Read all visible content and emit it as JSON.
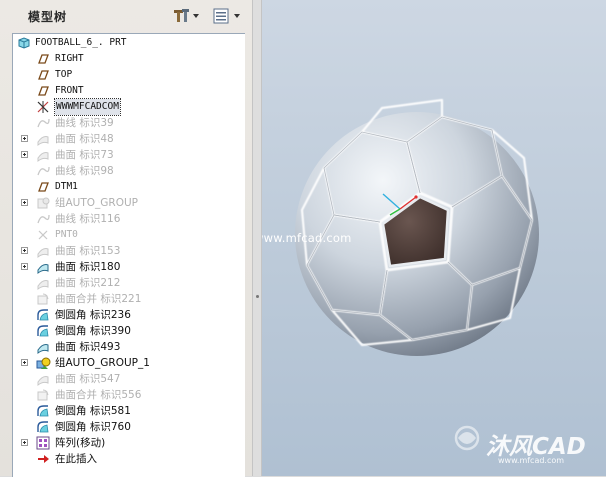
{
  "panel": {
    "title": "模型树",
    "settings_icon": "tools-icon",
    "show_icon": "list-icon"
  },
  "tree": {
    "root": "FOOTBALL_6_. PRT",
    "items": [
      {
        "label": "RIGHT",
        "icon": "datum-plane-icon",
        "state": "normal",
        "expander": false,
        "mono": true
      },
      {
        "label": "TOP",
        "icon": "datum-plane-icon",
        "state": "normal",
        "expander": false,
        "mono": true
      },
      {
        "label": "FRONT",
        "icon": "datum-plane-icon",
        "state": "normal",
        "expander": false,
        "mono": true
      },
      {
        "label": "WWWMFCADCOM",
        "icon": "coordinate-system-icon",
        "state": "selected",
        "expander": false,
        "mono": true
      },
      {
        "label": "曲线 标识39",
        "icon": "curve-icon",
        "state": "suppressed",
        "expander": false,
        "mono": false
      },
      {
        "label": "曲面 标识48",
        "icon": "surface-icon",
        "state": "suppressed",
        "expander": true,
        "mono": false
      },
      {
        "label": "曲面 标识73",
        "icon": "surface-icon",
        "state": "suppressed",
        "expander": true,
        "mono": false
      },
      {
        "label": "曲线 标识98",
        "icon": "curve-icon",
        "state": "suppressed",
        "expander": false,
        "mono": false
      },
      {
        "label": "DTM1",
        "icon": "datum-plane-icon",
        "state": "normal",
        "expander": false,
        "mono": true
      },
      {
        "label": "组AUTO_GROUP",
        "icon": "group-icon",
        "state": "suppressed",
        "expander": true,
        "mono": false
      },
      {
        "label": "曲线 标识116",
        "icon": "curve-icon",
        "state": "suppressed",
        "expander": false,
        "mono": false
      },
      {
        "label": "PNT0",
        "icon": "datum-point-icon",
        "state": "suppressed",
        "expander": false,
        "mono": true
      },
      {
        "label": "曲面 标识153",
        "icon": "surface-icon",
        "state": "suppressed",
        "expander": true,
        "mono": false
      },
      {
        "label": "曲面 标识180",
        "icon": "surface-icon",
        "state": "normal",
        "expander": true,
        "mono": false
      },
      {
        "label": "曲面 标识212",
        "icon": "surface-icon",
        "state": "suppressed",
        "expander": false,
        "mono": false
      },
      {
        "label": "曲面合并 标识221",
        "icon": "merge-icon",
        "state": "suppressed",
        "expander": false,
        "mono": false
      },
      {
        "label": "倒圆角 标识236",
        "icon": "round-icon",
        "state": "normal",
        "expander": false,
        "mono": false
      },
      {
        "label": "倒圆角 标识390",
        "icon": "round-icon",
        "state": "normal",
        "expander": false,
        "mono": false
      },
      {
        "label": "曲面 标识493",
        "icon": "surface-icon",
        "state": "normal",
        "expander": false,
        "mono": false
      },
      {
        "label": "组AUTO_GROUP_1",
        "icon": "group-icon",
        "state": "normal",
        "expander": true,
        "mono": false
      },
      {
        "label": "曲面 标识547",
        "icon": "surface-icon",
        "state": "suppressed",
        "expander": false,
        "mono": false
      },
      {
        "label": "曲面合并 标识556",
        "icon": "merge-icon",
        "state": "suppressed",
        "expander": false,
        "mono": false
      },
      {
        "label": "倒圆角 标识581",
        "icon": "round-icon",
        "state": "normal",
        "expander": false,
        "mono": false
      },
      {
        "label": "倒圆角 标识760",
        "icon": "round-icon",
        "state": "normal",
        "expander": false,
        "mono": false
      },
      {
        "label": "阵列(移动)",
        "icon": "pattern-icon",
        "state": "normal",
        "expander": true,
        "mono": false
      },
      {
        "label": "在此插入",
        "icon": "insert-arrow-icon",
        "state": "normal",
        "expander": false,
        "mono": false
      }
    ]
  },
  "viewport": {
    "watermark": "www.mfcad.com",
    "logo_text": "沐风CAD",
    "logo_url": "www.mfcad.com",
    "model": "soccer-ball-model"
  },
  "colors": {
    "ball_highlight": "#f2f5f8",
    "ball_shadow": "#6a7584",
    "pentagon": "#5a4640",
    "background": "#c2cfdd",
    "selection_outline": "#333333"
  }
}
